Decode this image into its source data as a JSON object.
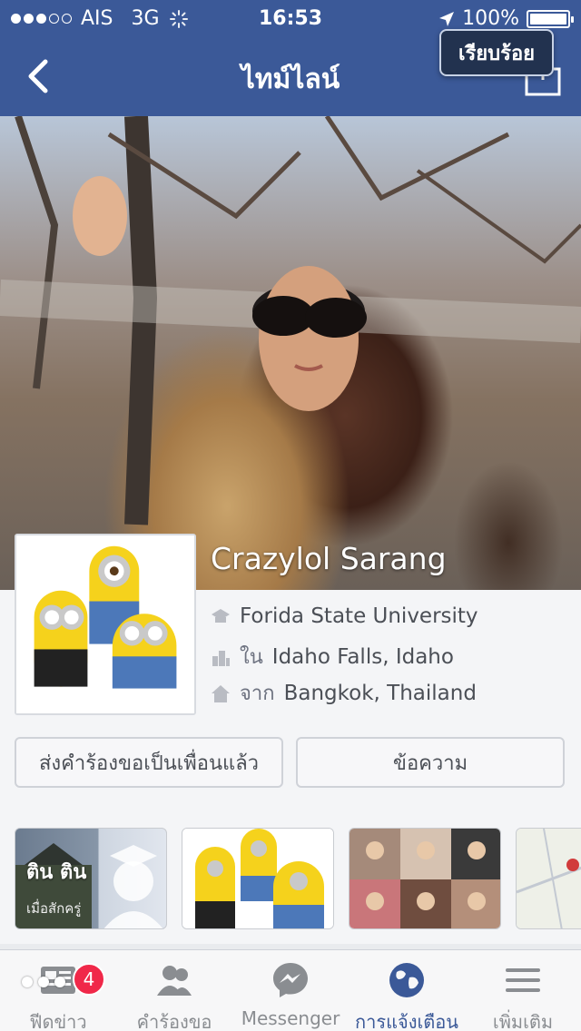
{
  "status_bar": {
    "carrier": "AIS",
    "network": "3G",
    "time": "16:53",
    "battery_level": "100%"
  },
  "nav": {
    "title": "ไทม์ไลน์",
    "done_tooltip": "เรียบร้อย"
  },
  "profile": {
    "name": "Crazylol Sarang",
    "education_value": "Forida State University",
    "lives_prefix": "ใน",
    "lives_value": "Idaho Falls, Idaho",
    "from_prefix": "จาก",
    "from_value": "Bangkok, Thailand"
  },
  "actions": {
    "friend_request_sent": "ส่งคำร้องขอเป็นเพื่อนแล้ว",
    "message": "ข้อความ"
  },
  "thumbnails": [
    {
      "title": "ติน ติน",
      "subtitle": "เมื่อสักครู่"
    }
  ],
  "tab_bar": {
    "badge_count": "4",
    "tabs": [
      {
        "label": "ฟีดข่าว",
        "icon": "news-feed-icon"
      },
      {
        "label": "คำร้องขอ",
        "icon": "friend-requests-icon"
      },
      {
        "label": "Messenger",
        "icon": "messenger-icon"
      },
      {
        "label": "การแจ้งเตือน",
        "icon": "globe-icon"
      },
      {
        "label": "เพิ่มเติม",
        "icon": "hamburger-menu-icon"
      }
    ]
  },
  "colors": {
    "brand_blue": "#3b5998",
    "badge_red": "#f02849"
  }
}
